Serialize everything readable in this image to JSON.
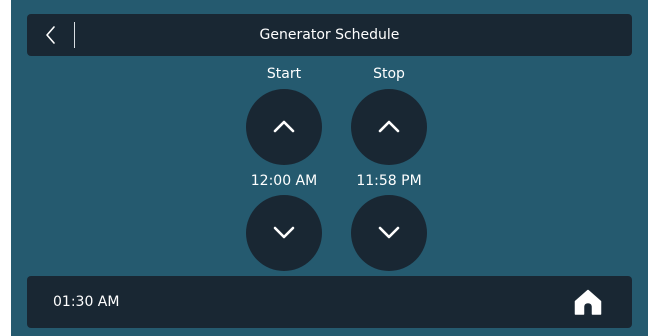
{
  "header": {
    "title": "Generator Schedule",
    "back_icon": "chevron-left-icon"
  },
  "schedule": {
    "start": {
      "label": "Start",
      "time": "12:00 AM"
    },
    "stop": {
      "label": "Stop",
      "time": "11:58 PM"
    },
    "increase_icon": "chevron-up-icon",
    "decrease_icon": "chevron-down-icon"
  },
  "footer": {
    "clock": "01:30 AM",
    "home_icon": "home-icon"
  },
  "colors": {
    "background": "#255a6f",
    "panel": "#192733",
    "text": "#ffffff"
  }
}
